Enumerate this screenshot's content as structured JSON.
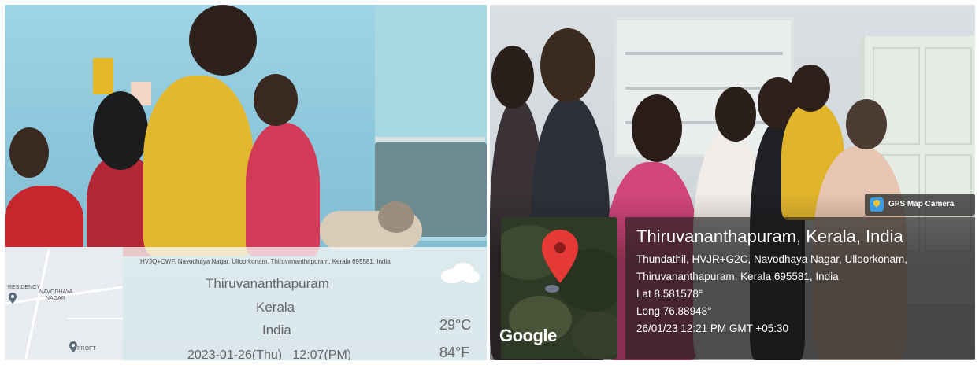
{
  "left_photo": {
    "address_line": "HVJQ+CWF, Navodhaya Nagar, Ulloorkonam, Thiruvananthapuram, Kerala 695581, India",
    "city": "Thiruvananthapuram",
    "state": "Kerala",
    "country": "India",
    "datetime": "2023-01-26(Thu)   12:07(PM)",
    "temp_c": "29°C",
    "temp_f": "84°F",
    "weather_icon": "cloud-icon",
    "map_labels": [
      "RESIDENCY",
      "NAVODHAYA",
      "NAGAR",
      "PROFT"
    ]
  },
  "right_photo": {
    "app_badge": "GPS Map Camera",
    "app_icon": "gps-map-camera-icon",
    "title": "Thiruvananthapuram, Kerala, India",
    "address_line_1": "Thundathil, HVJR+G2C, Navodhaya Nagar, Ulloorkonam,",
    "address_line_2": "Thiruvananthapuram, Kerala 695581, India",
    "lat": "Lat 8.581578°",
    "long": "Long 76.88948°",
    "datetime": "26/01/23 12:21 PM GMT +05:30",
    "map_brand": "Google",
    "pin_color": "#e53935"
  }
}
